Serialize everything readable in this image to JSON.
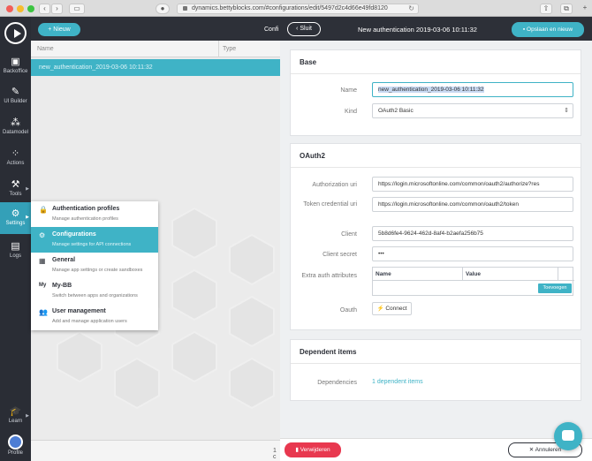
{
  "browser": {
    "url": "dynamics.bettyblocks.com/#configurations/edit/5497d2c4d66e49fd8120"
  },
  "sidebar": {
    "items": [
      {
        "label": "Backoffice",
        "icon": "backoffice-icon"
      },
      {
        "label": "UI Builder",
        "icon": "ui-builder-icon"
      },
      {
        "label": "Datamodel",
        "icon": "datamodel-icon"
      },
      {
        "label": "Actions",
        "icon": "actions-icon"
      },
      {
        "label": "Tools",
        "icon": "tools-icon"
      },
      {
        "label": "Settings",
        "icon": "gear-icon"
      },
      {
        "label": "Logs",
        "icon": "logs-icon"
      },
      {
        "label": "Learn",
        "icon": "learn-icon"
      },
      {
        "label": "Profile",
        "icon": "avatar-icon"
      }
    ]
  },
  "header": {
    "new_label": "+ Nieuw",
    "configurations_label": "Confi",
    "close_label": "Sluit",
    "title": "New authentication 2019-03-06 10:11:32",
    "save_new_label": "Opslaan en nieuw"
  },
  "list": {
    "columns": [
      "Name",
      "Type"
    ],
    "rows": [
      {
        "name": "new_authentication_2019-03-06 10:11:32",
        "type": ""
      }
    ],
    "footer": "1 c"
  },
  "menu": {
    "items": [
      {
        "title": "Authentication profiles",
        "subtitle": "Manage authentication profiles",
        "active": false
      },
      {
        "title": "Configurations",
        "subtitle": "Manage settings for API connections",
        "active": true
      },
      {
        "title": "General",
        "subtitle": "Manage app settings or create sandboxes",
        "active": false
      },
      {
        "title": "My-BB",
        "subtitle": "Switch between apps and organizations",
        "active": false,
        "icon_text": "My"
      },
      {
        "title": "User management",
        "subtitle": "Add and manage application users",
        "active": false
      }
    ]
  },
  "base": {
    "heading": "Base",
    "name_label": "Name",
    "name_value": "new_authentication_2019-03-06 10:11:32",
    "kind_label": "Kind",
    "kind_value": "OAuth2 Basic"
  },
  "oauth2": {
    "heading": "OAuth2",
    "authorization_uri_label": "Authorization uri",
    "authorization_uri_value": "https://login.microsoftonline.com/common/oauth2/authorize?res",
    "token_credential_uri_label": "Token credential uri",
    "token_credential_uri_value": "https://login.microsoftonline.com/common/oauth2/token",
    "client_label": "Client",
    "client_value": "5b8d6fe4-9624-462d-8af4-b2aefa256b75",
    "client_secret_label": "Client secret",
    "client_secret_value": "•••",
    "extra_auth_label": "Extra auth attributes",
    "extra_auth_columns": [
      "Name",
      "Value"
    ],
    "add_label": "Toevoegen",
    "oauth_label": "Oauth",
    "connect_label": "Connect"
  },
  "dependent": {
    "heading": "Dependent items",
    "dependencies_label": "Dependencies",
    "dependencies_value": "1 dependent items"
  },
  "footer": {
    "delete_label": "Verwijderen",
    "cancel_label": "Annuleren"
  },
  "colors": {
    "accent": "#3fb3c6",
    "danger": "#e8384f",
    "dark": "#2d3038"
  }
}
